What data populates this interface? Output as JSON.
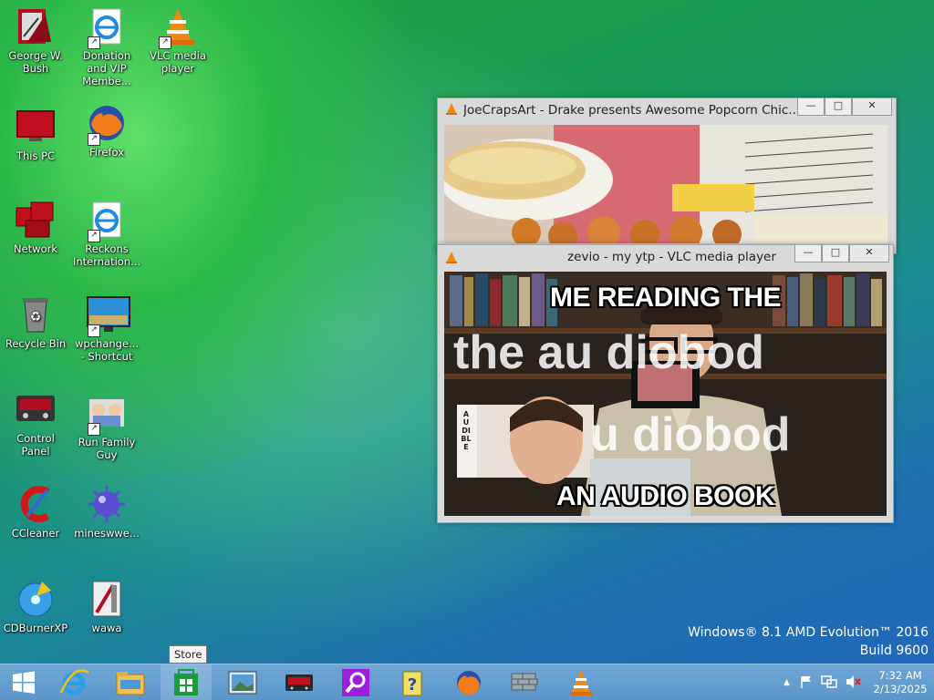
{
  "desktop_icons": [
    {
      "label": "George W. Bush",
      "icon": "bush-icon"
    },
    {
      "label": "Donation and VIP Membe...",
      "icon": "internet-explorer-icon"
    },
    {
      "label": "VLC media player",
      "icon": "vlc-cone-icon"
    },
    {
      "label": "This PC",
      "icon": "monitor-icon"
    },
    {
      "label": "Firefox",
      "icon": "firefox-icon"
    },
    {
      "label": "Network",
      "icon": "network-icon"
    },
    {
      "label": "Reckons Internation...",
      "icon": "internet-explorer-icon"
    },
    {
      "label": "Recycle Bin",
      "icon": "recycle-bin-icon"
    },
    {
      "label": "wpchange... - Shortcut",
      "icon": "wallpaper-icon"
    },
    {
      "label": "Control Panel",
      "icon": "control-panel-icon"
    },
    {
      "label": "Run Family Guy",
      "icon": "family-guy-icon"
    },
    {
      "label": "CCleaner",
      "icon": "ccleaner-icon"
    },
    {
      "label": "mineswwe...",
      "icon": "mine-icon"
    },
    {
      "label": "CDBurnerXP",
      "icon": "cd-icon"
    },
    {
      "label": "wawa",
      "icon": "wawa-icon"
    }
  ],
  "windows": {
    "back": {
      "title": "JoeCrapsArt - Drake presents Awesome Popcorn Chic..."
    },
    "front": {
      "title": "zevio - my ytp - VLC media player",
      "caption_top": "ME READING THE",
      "caption_bottom": "AN AUDIO BOOK",
      "bg_text_1": "the au     diobod",
      "bg_text_2": "u         diobod",
      "sidebar_text": "AUDIBLE"
    },
    "controls": {
      "minimize": "—",
      "maximize": "□",
      "close": "✕"
    }
  },
  "watermark": {
    "line1": "Windows® 8.1 AMD Evolution™ 2016",
    "line2": "Build 9600"
  },
  "tooltip": "Store",
  "taskbar": {
    "start": "start-icon",
    "pinned": [
      "internet-explorer-icon",
      "file-explorer-icon",
      "store-icon",
      "photos-icon",
      "media-icon",
      "search-icon",
      "help-icon",
      "firefox-icon",
      "wall-icon",
      "vlc-cone-icon"
    ]
  },
  "tray": {
    "time": "7:32 AM",
    "date": "2/13/2025",
    "chevron": "▲"
  }
}
